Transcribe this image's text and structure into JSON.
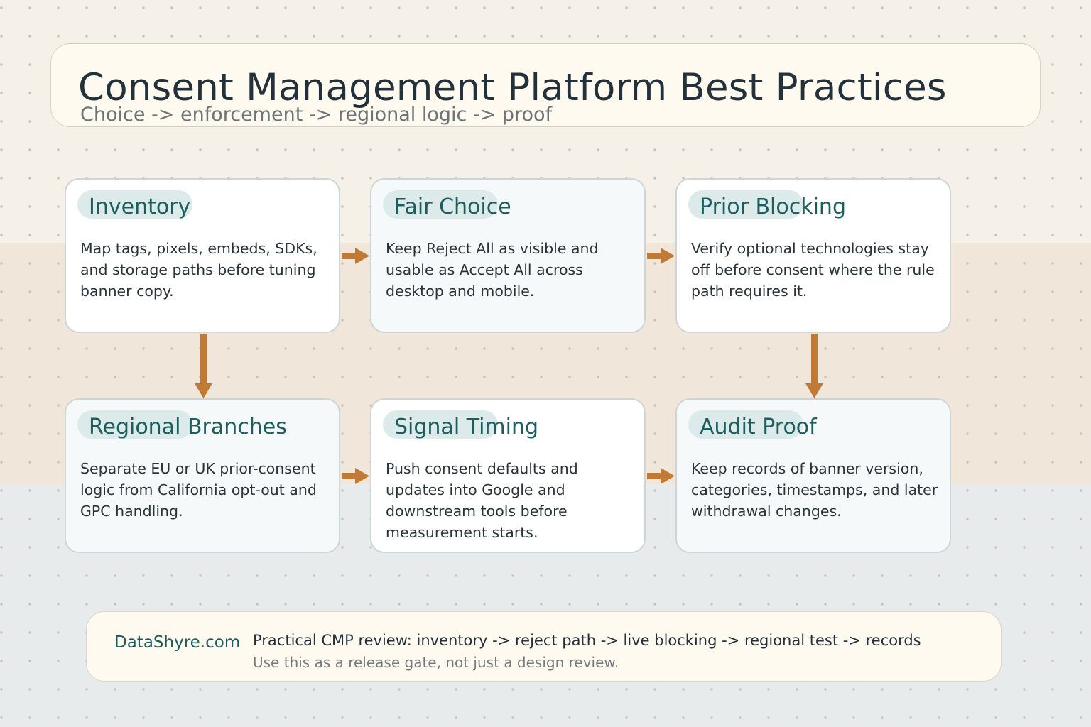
{
  "header": {
    "title": "Consent Management Platform Best Practices",
    "subtitle": "Choice -> enforcement -> regional logic -> proof"
  },
  "steps": [
    {
      "title": "Inventory",
      "body": "Map tags, pixels, embeds, SDKs, and storage paths before tuning banner copy."
    },
    {
      "title": "Fair Choice",
      "body": "Keep Reject All as visible and usable as Accept All across desktop and mobile."
    },
    {
      "title": "Prior Blocking",
      "body": "Verify optional technologies stay off before consent where the rule path requires it."
    },
    {
      "title": "Regional Branches",
      "body": "Separate EU or UK prior-consent logic from California opt-out and GPC handling."
    },
    {
      "title": "Signal Timing",
      "body": "Push consent defaults and updates into Google and downstream tools before measurement starts."
    },
    {
      "title": "Audit Proof",
      "body": "Keep records of banner version, categories, timestamps, and later withdrawal changes."
    }
  ],
  "footer": {
    "brand": "DataShyre.com",
    "main": "Practical CMP review: inventory -> reject path -> live blocking -> regional test -> records",
    "note": "Use this as a release gate, not just a design review."
  },
  "colors": {
    "arrow": "#c07a35",
    "accent": "#1c5e60",
    "pill": "#dcebe9"
  }
}
